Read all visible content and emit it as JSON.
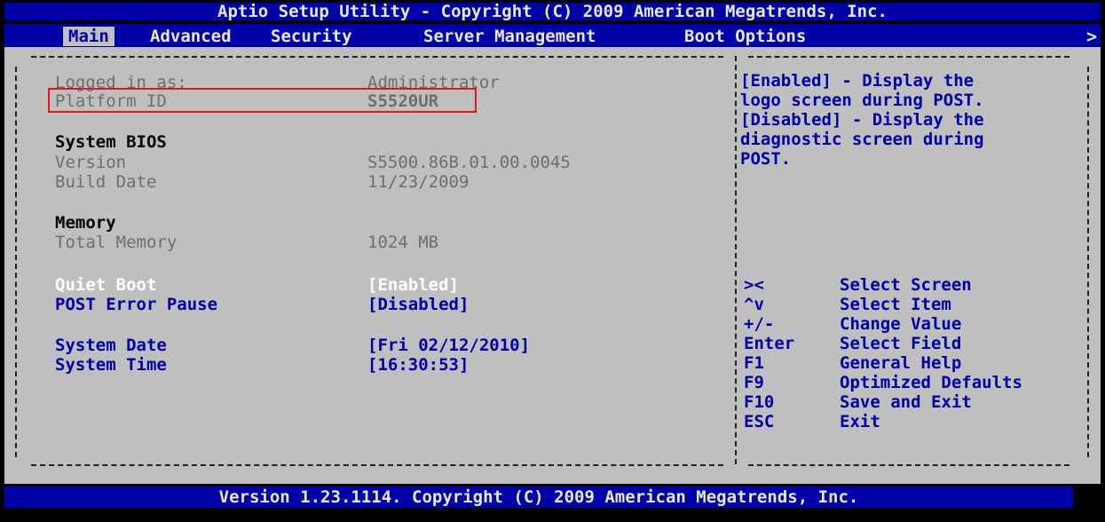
{
  "title": "Aptio Setup Utility - Copyright (C) 2009 American Megatrends, Inc.",
  "tabs": [
    "Main",
    "Advanced",
    "Security",
    "Server Management",
    "Boot Options"
  ],
  "menu_more": ">",
  "info": {
    "logged_label": "Logged in as:",
    "logged_value": "Administrator",
    "platform_label": "Platform ID",
    "platform_value": "S5520UR",
    "bios_heading": "System BIOS",
    "version_label": "Version",
    "version_value": "S5500.86B.01.00.0045",
    "build_label": "Build Date",
    "build_value": "11/23/2009",
    "memory_heading": "Memory",
    "total_memory_label": "Total Memory",
    "total_memory_value": "1024 MB"
  },
  "settings": {
    "quiet_boot_label": "Quiet Boot",
    "quiet_boot_value": "[Enabled]",
    "post_error_label": "POST Error Pause",
    "post_error_value": "[Disabled]",
    "date_label": "System Date",
    "date_value": "[Fri 02/12/2010]",
    "time_label": "System Time",
    "time_value": "[16:30:53]"
  },
  "help_text": [
    "[Enabled] - Display the",
    "logo screen during POST.",
    "[Disabled] - Display the",
    "diagnostic screen during",
    "POST."
  ],
  "keys": [
    {
      "key": "><",
      "action": "Select Screen"
    },
    {
      "key": "^v",
      "action": "Select Item"
    },
    {
      "key": "+/-",
      "action": "Change Value"
    },
    {
      "key": "Enter",
      "action": "Select Field"
    },
    {
      "key": "F1",
      "action": "General Help"
    },
    {
      "key": "F9",
      "action": "Optimized Defaults"
    },
    {
      "key": "F10",
      "action": "Save and Exit"
    },
    {
      "key": "ESC",
      "action": "Exit"
    }
  ],
  "footer": "Version 1.23.1114. Copyright (C) 2009 American Megatrends, Inc.",
  "colors": {
    "bar": "#0000a8",
    "panel": "#bfbfbf",
    "highlight_box": "#e01818"
  }
}
